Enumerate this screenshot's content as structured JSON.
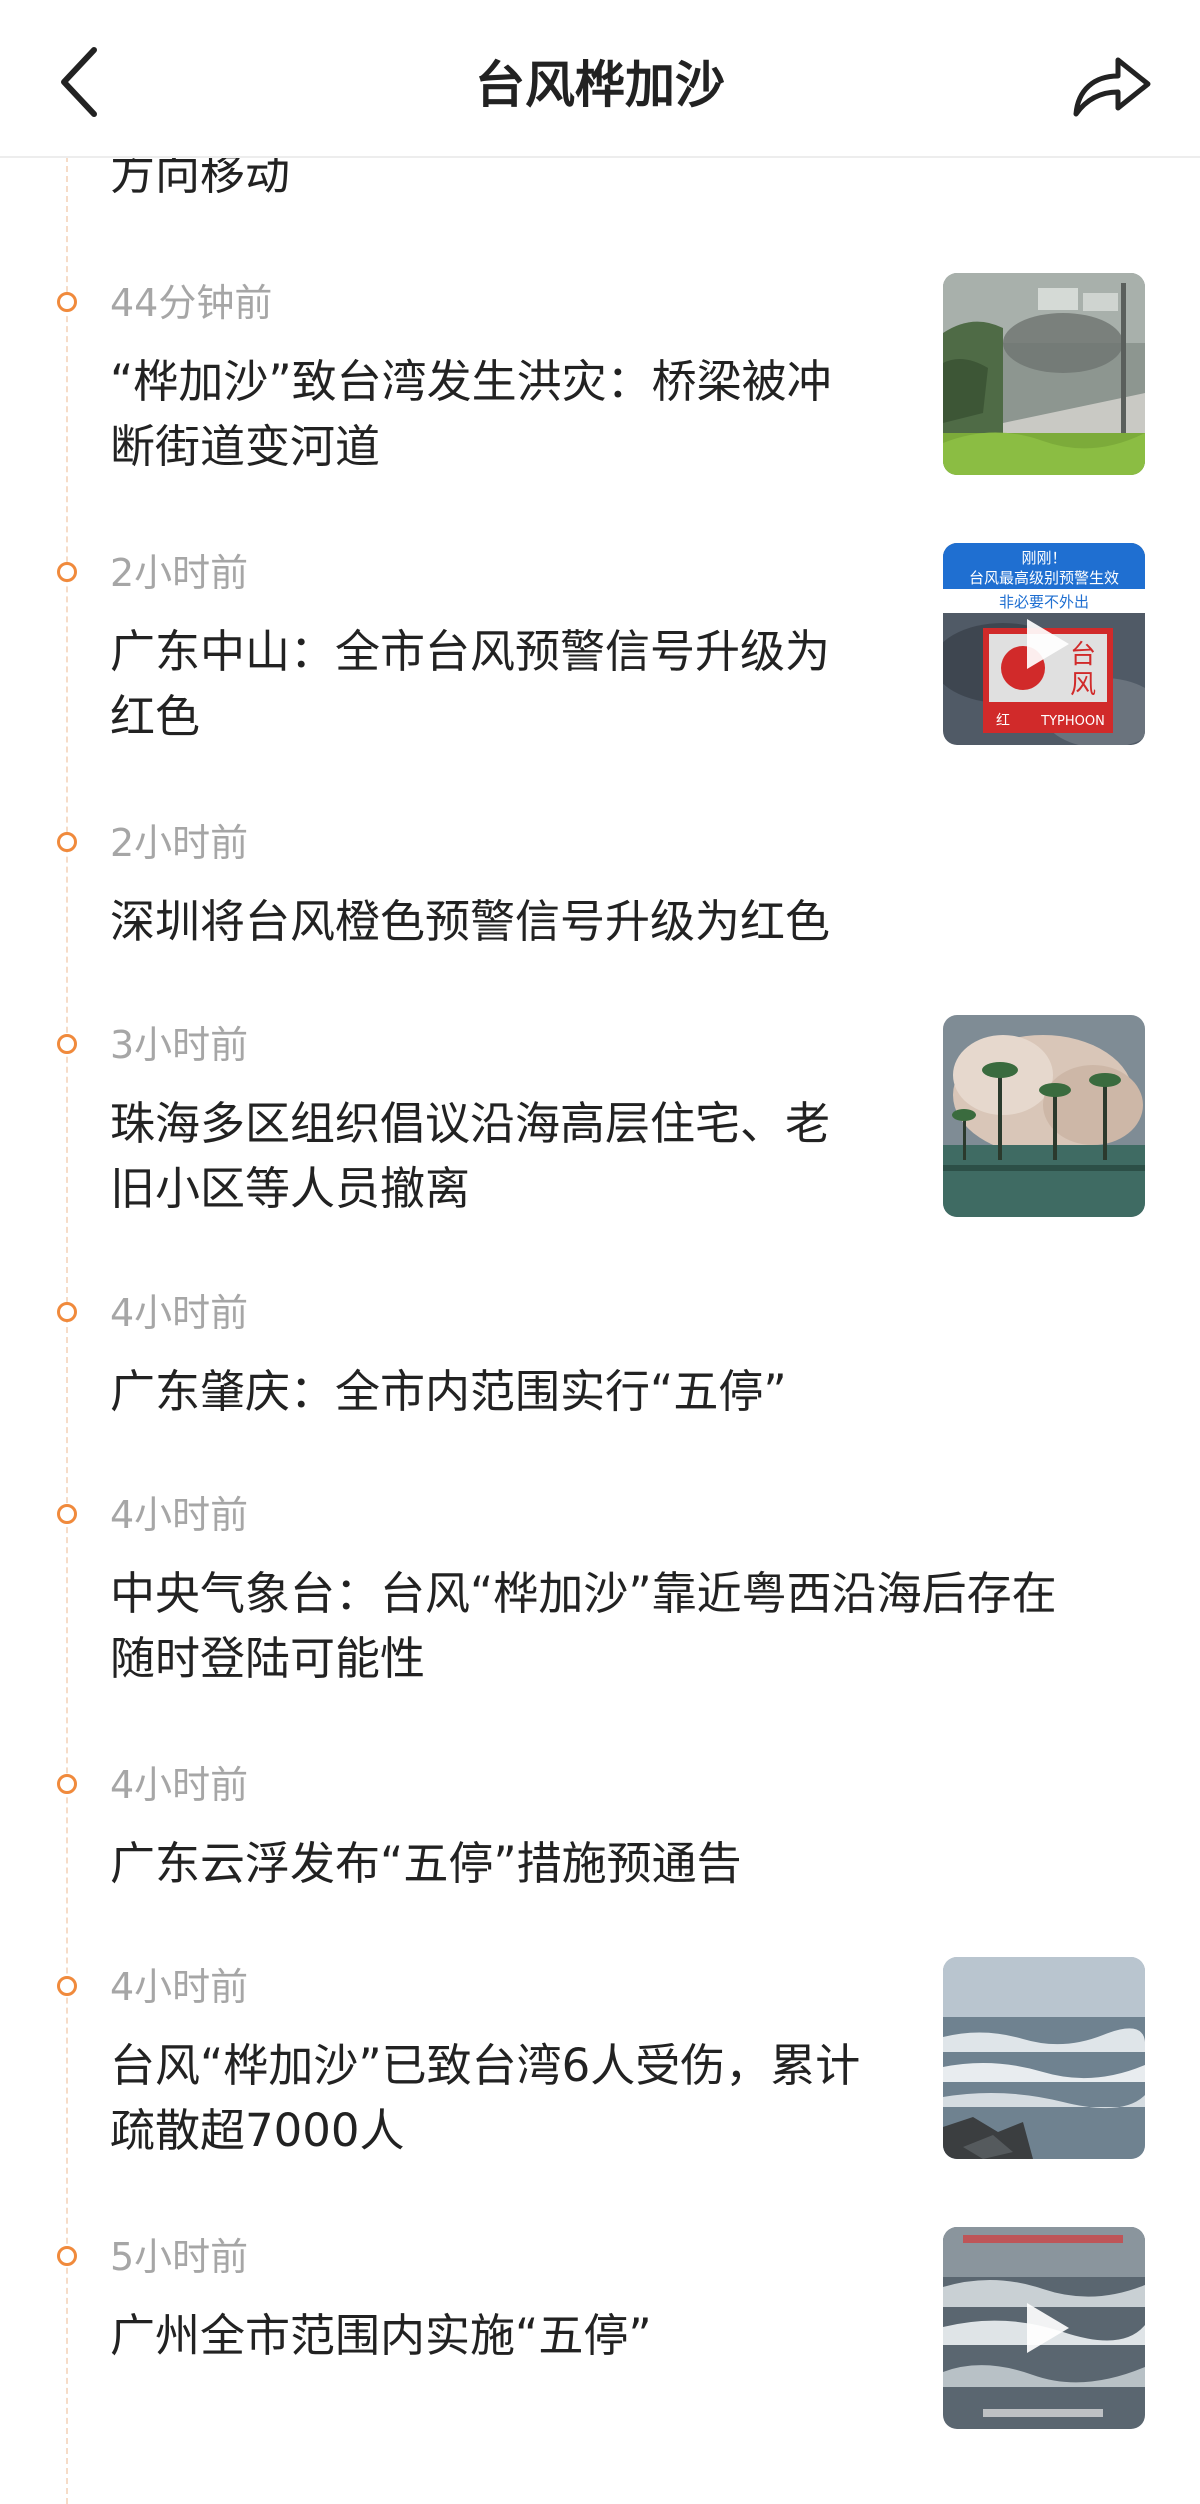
{
  "header": {
    "title": "台风桦加沙"
  },
  "partial_item": {
    "title": "方向移动"
  },
  "items": [
    {
      "time": "44分钟前",
      "title_lines": [
        "“桦加沙”致台湾发生洪灾：桥梁被冲",
        "断街道变河道"
      ],
      "thumbnail": "flood-road-photo"
    },
    {
      "time": "2小时前",
      "title_lines": [
        "广东中山：全市台风预警信号升级为",
        "红色"
      ],
      "thumbnail": "typhoon-red-warning-video",
      "thumb_text": {
        "line1": "刚刚！",
        "line2": "台风最高级别预警生效",
        "line3": "非必要不外出",
        "sign_cn_1": "台",
        "sign_cn_2": "风",
        "sign_red": "红",
        "sign_en": "TYPHOON"
      }
    },
    {
      "time": "2小时前",
      "title_lines": [
        "深圳将台风橙色预警信号升级为红色"
      ]
    },
    {
      "time": "3小时前",
      "title_lines": [
        "珠海多区组织倡议沿海高层住宅、老",
        "旧小区等人员撤离"
      ],
      "thumbnail": "waves-palm-trees-photo"
    },
    {
      "time": "4小时前",
      "title_lines": [
        "广东肇庆：全市内范围实行“五停”"
      ]
    },
    {
      "time": "4小时前",
      "title_lines": [
        "中央气象台：台风“桦加沙”靠近粤西沿海后存在",
        "随时登陆可能性"
      ]
    },
    {
      "time": "4小时前",
      "title_lines": [
        "广东云浮发布“五停”措施预通告"
      ]
    },
    {
      "time": "4小时前",
      "title_lines": [
        "台风“桦加沙”已致台湾6人受伤，累计",
        "疏散超7000人"
      ],
      "thumbnail": "rough-sea-photo"
    },
    {
      "time": "5小时前",
      "title_lines": [
        "广州全市范围内实施“五停”"
      ],
      "thumbnail": "stormy-sea-video"
    }
  ]
}
